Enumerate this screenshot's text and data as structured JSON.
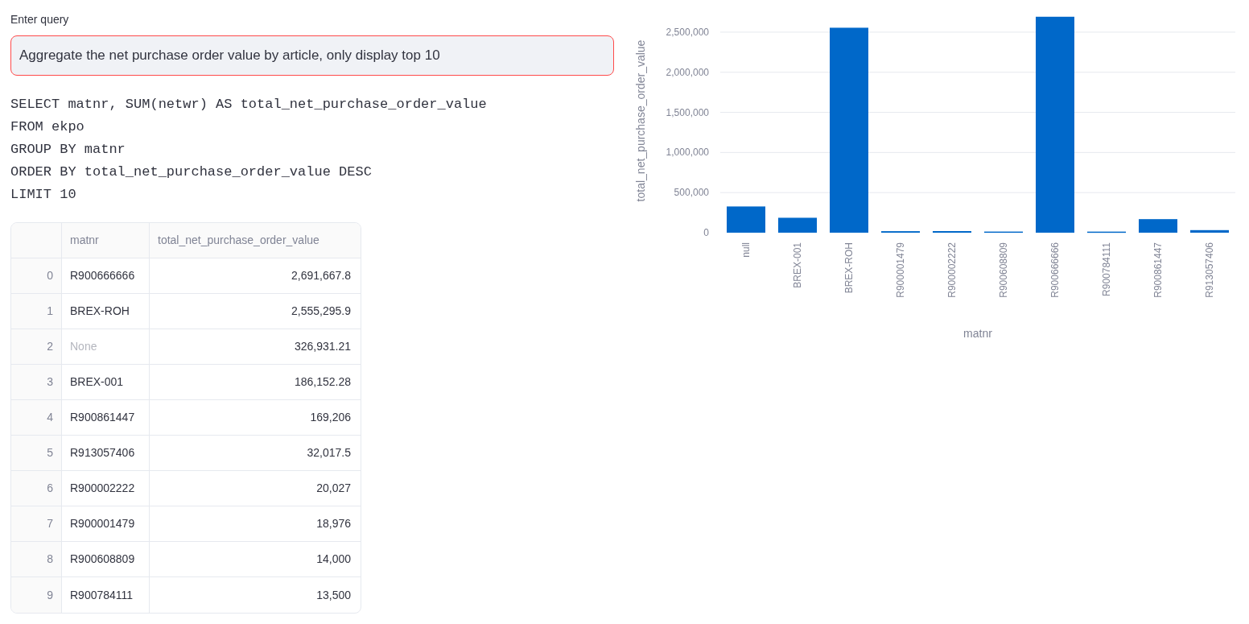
{
  "query": {
    "label": "Enter query",
    "value": "Aggregate the net purchase order value by article, only display top 10"
  },
  "sql_lines": [
    "SELECT matnr, SUM(netwr) AS total_net_purchase_order_value",
    "FROM ekpo",
    "GROUP BY matnr",
    "ORDER BY total_net_purchase_order_value DESC",
    "LIMIT 10"
  ],
  "table": {
    "columns": [
      "matnr",
      "total_net_purchase_order_value"
    ],
    "rows": [
      {
        "index": "0",
        "matnr": "R900666666",
        "value": "2,691,667.8",
        "is_null": false
      },
      {
        "index": "1",
        "matnr": "BREX-ROH",
        "value": "2,555,295.9",
        "is_null": false
      },
      {
        "index": "2",
        "matnr": "None",
        "value": "326,931.21",
        "is_null": true
      },
      {
        "index": "3",
        "matnr": "BREX-001",
        "value": "186,152.28",
        "is_null": false
      },
      {
        "index": "4",
        "matnr": "R900861447",
        "value": "169,206",
        "is_null": false
      },
      {
        "index": "5",
        "matnr": "R913057406",
        "value": "32,017.5",
        "is_null": false
      },
      {
        "index": "6",
        "matnr": "R900002222",
        "value": "20,027",
        "is_null": false
      },
      {
        "index": "7",
        "matnr": "R900001479",
        "value": "18,976",
        "is_null": false
      },
      {
        "index": "8",
        "matnr": "R900608809",
        "value": "14,000",
        "is_null": false
      },
      {
        "index": "9",
        "matnr": "R900784111",
        "value": "13,500",
        "is_null": false
      }
    ]
  },
  "chart": {
    "chart_data": {
      "type": "bar",
      "xlabel": "matnr",
      "ylabel": "total_net_purchase_order_value",
      "categories": [
        "null",
        "BREX-001",
        "BREX-ROH",
        "R900001479",
        "R900002222",
        "R900608809",
        "R900666666",
        "R900784111",
        "R900861447",
        "R913057406"
      ],
      "series": [
        {
          "color": "#0068c9",
          "values": [
            327000,
            186000,
            2555000,
            19000,
            20000,
            14000,
            2692000,
            13500,
            169000,
            32000
          ]
        }
      ],
      "grid": true,
      "ylim": [
        0,
        2700000
      ],
      "yticks": [
        {
          "value": 0,
          "label": "0"
        },
        {
          "value": 500000,
          "label": "500,000"
        },
        {
          "value": 1000000,
          "label": "1,000,000"
        },
        {
          "value": 1500000,
          "label": "1,500,000"
        },
        {
          "value": 2000000,
          "label": "2,000,000"
        },
        {
          "value": 2500000,
          "label": "2,500,000"
        }
      ]
    }
  }
}
